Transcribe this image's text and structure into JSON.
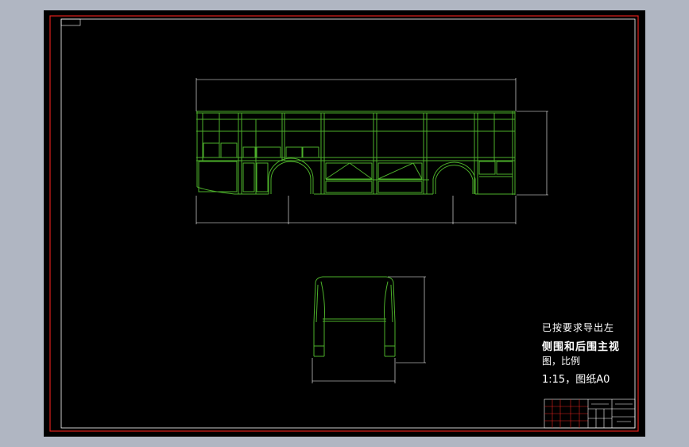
{
  "drawing": {
    "note_line1": "已按要求导出左",
    "note_line2": "侧围和后围主视",
    "note_line3": "图，比例",
    "note_line4": "1:15，图纸A0",
    "corner_tag": "",
    "colors": {
      "app_background": "#b0b6c2",
      "sheet": "#000000",
      "border": "#e0201c",
      "frame": "#4caf2a",
      "dimension": "#ffffff",
      "title_block": "#ffffff",
      "title_block_accent": "#e0201c"
    }
  },
  "views": {
    "side_view": "left-side-frame",
    "rear_view": "rear-frame"
  }
}
